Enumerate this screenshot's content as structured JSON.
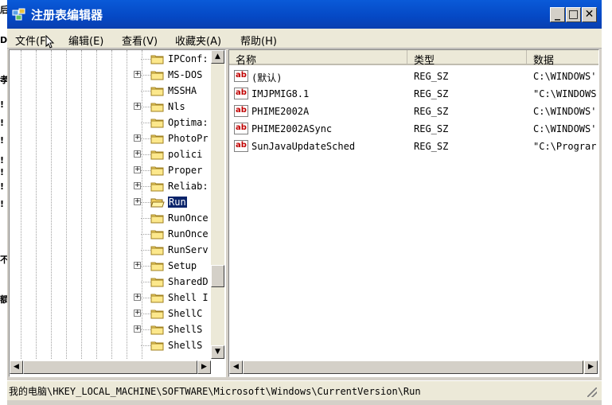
{
  "window": {
    "title": "注册表编辑器"
  },
  "menu": [
    {
      "label": "文件(F)"
    },
    {
      "label": "编辑(E)"
    },
    {
      "label": "查看(V)"
    },
    {
      "label": "收藏夹(A)"
    },
    {
      "label": "帮助(H)"
    }
  ],
  "tree": {
    "items": [
      {
        "label": "IPConf:",
        "expandable": false
      },
      {
        "label": "MS-DOS",
        "expandable": true
      },
      {
        "label": "MSSHA",
        "expandable": false
      },
      {
        "label": "Nls",
        "expandable": true
      },
      {
        "label": "Optima:",
        "expandable": false
      },
      {
        "label": "PhotoPr",
        "expandable": true
      },
      {
        "label": "polici",
        "expandable": true
      },
      {
        "label": "Proper",
        "expandable": true
      },
      {
        "label": "Reliab:",
        "expandable": true
      },
      {
        "label": "Run",
        "expandable": true,
        "selected": true
      },
      {
        "label": "RunOnce",
        "expandable": false
      },
      {
        "label": "RunOnce",
        "expandable": false
      },
      {
        "label": "RunServ",
        "expandable": false
      },
      {
        "label": "Setup",
        "expandable": true
      },
      {
        "label": "SharedD",
        "expandable": false
      },
      {
        "label": "Shell I",
        "expandable": true
      },
      {
        "label": "ShellC",
        "expandable": true
      },
      {
        "label": "ShellS",
        "expandable": true
      },
      {
        "label": "ShellS",
        "expandable": false
      }
    ]
  },
  "list": {
    "columns": [
      "名称",
      "类型",
      "数据"
    ],
    "rows": [
      {
        "name": "(默认)",
        "type": "REG_SZ",
        "data": "C:\\WINDOWS'"
      },
      {
        "name": "IMJPMIG8.1",
        "type": "REG_SZ",
        "data": "\"C:\\WINDOWS"
      },
      {
        "name": "PHIME2002A",
        "type": "REG_SZ",
        "data": "C:\\WINDOWS'"
      },
      {
        "name": "PHIME2002ASync",
        "type": "REG_SZ",
        "data": "C:\\WINDOWS'"
      },
      {
        "name": "SunJavaUpdateSched",
        "type": "REG_SZ",
        "data": "\"C:\\Prograr"
      }
    ]
  },
  "status": {
    "path": "我的电脑\\HKEY_LOCAL_MACHINE\\SOFTWARE\\Microsoft\\Windows\\CurrentVersion\\Run"
  },
  "background": {
    "left_chars": [
      "后",
      "D",
      "孝",
      "!",
      "!",
      "!",
      "!",
      "!",
      "!",
      "!",
      "不",
      "额"
    ]
  },
  "colors": {
    "titlebar": "#0548c4",
    "selection": "#0a246a",
    "chrome": "#d4d0c8"
  }
}
